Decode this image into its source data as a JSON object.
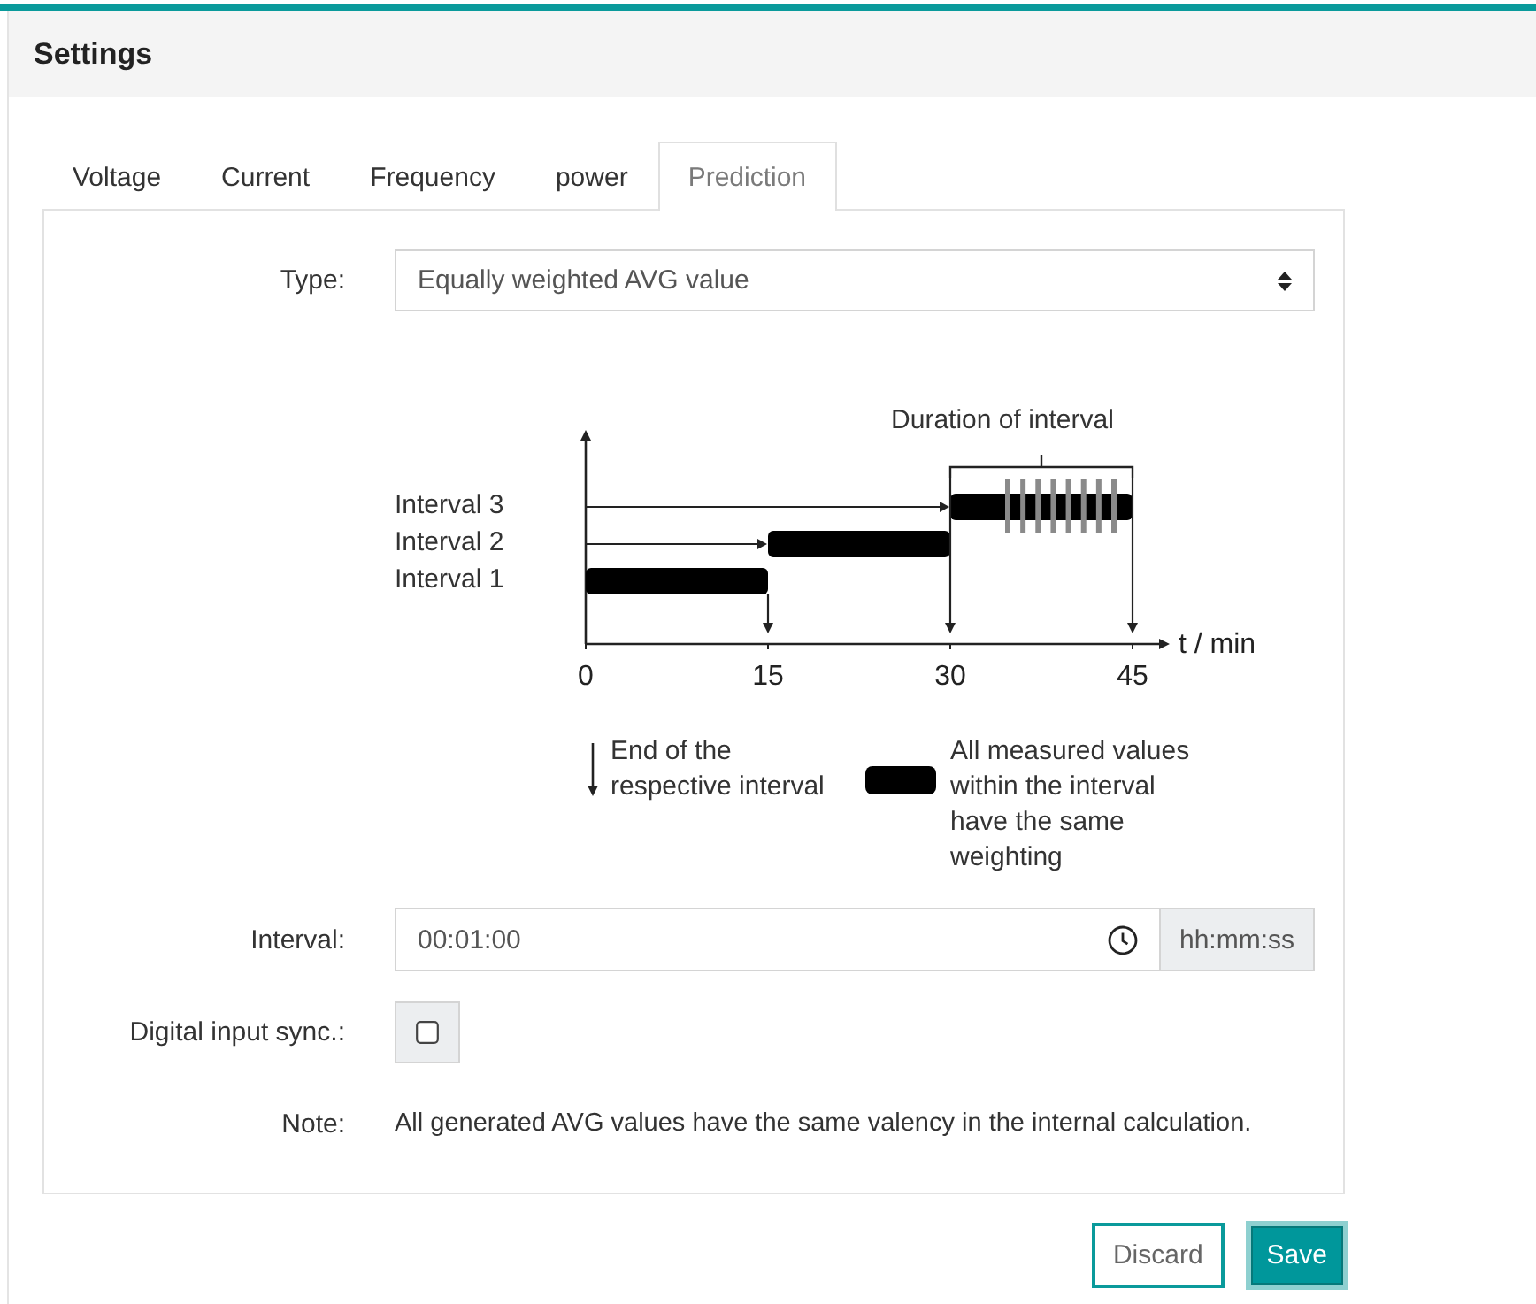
{
  "window": {
    "title": "Settings"
  },
  "tabs": [
    {
      "label": "Voltage",
      "selected": false
    },
    {
      "label": "Current",
      "selected": false
    },
    {
      "label": "Frequency",
      "selected": false
    },
    {
      "label": "power",
      "selected": false
    },
    {
      "label": "Prediction",
      "selected": true
    }
  ],
  "type_field": {
    "label": "Type:",
    "value": "Equally weighted AVG value"
  },
  "diagram": {
    "title": "Duration of interval",
    "x_axis_label": "t / min",
    "ticks": [
      "0",
      "15",
      "30",
      "45"
    ],
    "intervals": [
      {
        "label": "Interval 3",
        "hatched": true
      },
      {
        "label": "Interval 2",
        "hatched": false
      },
      {
        "label": "Interval 1",
        "hatched": false
      }
    ],
    "legend": [
      {
        "kind": "arrow",
        "text": "End of the respective interval"
      },
      {
        "kind": "bar",
        "text": "All measured values within the interval have the same weighting"
      }
    ]
  },
  "interval_field": {
    "label": "Interval:",
    "value": "00:01:00",
    "unit": "hh:mm:ss"
  },
  "sync_field": {
    "label": "Digital input sync.:",
    "checked": false
  },
  "note": {
    "label": "Note:",
    "text": "All generated AVG values have the same valency in the internal calculation."
  },
  "buttons": [
    {
      "label": "Discard",
      "kind": "secondary",
      "focused": false
    },
    {
      "label": "Save",
      "kind": "primary",
      "focused": true
    }
  ]
}
